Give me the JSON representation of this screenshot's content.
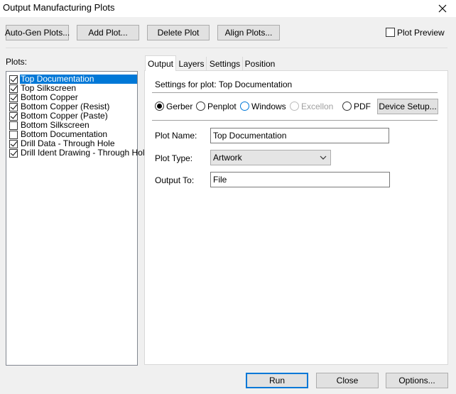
{
  "window": {
    "title": "Output Manufacturing Plots"
  },
  "icons": {
    "close": "close-icon",
    "dropdown": "chevron-down-icon"
  },
  "toolbar": {
    "auto_gen_label": "Auto-Gen Plots...",
    "add_plot_label": "Add Plot...",
    "delete_plot_label": "Delete Plot",
    "align_plots_label": "Align Plots...",
    "plot_preview_label": "Plot Preview",
    "plot_preview_checked": false
  },
  "plots": {
    "label": "Plots:",
    "items": [
      {
        "label": "Top Documentation",
        "checked": true,
        "selected": true
      },
      {
        "label": "Top Silkscreen",
        "checked": true,
        "selected": false
      },
      {
        "label": "Bottom Copper",
        "checked": true,
        "selected": false
      },
      {
        "label": "Bottom Copper (Resist)",
        "checked": true,
        "selected": false
      },
      {
        "label": "Bottom Copper (Paste)",
        "checked": true,
        "selected": false
      },
      {
        "label": "Bottom Silkscreen",
        "checked": false,
        "selected": false
      },
      {
        "label": "Bottom Documentation",
        "checked": false,
        "selected": false
      },
      {
        "label": "Drill Data - Through Hole",
        "checked": true,
        "selected": false
      },
      {
        "label": "Drill Ident Drawing - Through Hole",
        "checked": true,
        "selected": false
      }
    ]
  },
  "tabs": [
    {
      "label": "Output",
      "active": true
    },
    {
      "label": "Layers",
      "active": false
    },
    {
      "label": "Settings",
      "active": false
    },
    {
      "label": "Position",
      "active": false
    }
  ],
  "output_panel": {
    "settings_heading": "Settings for plot: Top Documentation",
    "formats": [
      {
        "label": "Gerber",
        "selected": true,
        "enabled": true
      },
      {
        "label": "Penplot",
        "selected": false,
        "enabled": true
      },
      {
        "label": "Windows",
        "selected": false,
        "enabled": true
      },
      {
        "label": "Excellon",
        "selected": false,
        "enabled": false
      },
      {
        "label": "PDF",
        "selected": false,
        "enabled": true
      }
    ],
    "device_setup_label": "Device Setup...",
    "plot_name_label": "Plot Name:",
    "plot_name_value": "Top Documentation",
    "plot_type_label": "Plot Type:",
    "plot_type_value": "Artwork",
    "output_to_label": "Output To:",
    "output_to_value": "File"
  },
  "footer": {
    "run_label": "Run",
    "close_label": "Close",
    "options_label": "Options..."
  },
  "colors": {
    "selection": "#0078d7",
    "disabled_text": "#a0a0a0",
    "dialog_bg": "#f0f0f0"
  }
}
